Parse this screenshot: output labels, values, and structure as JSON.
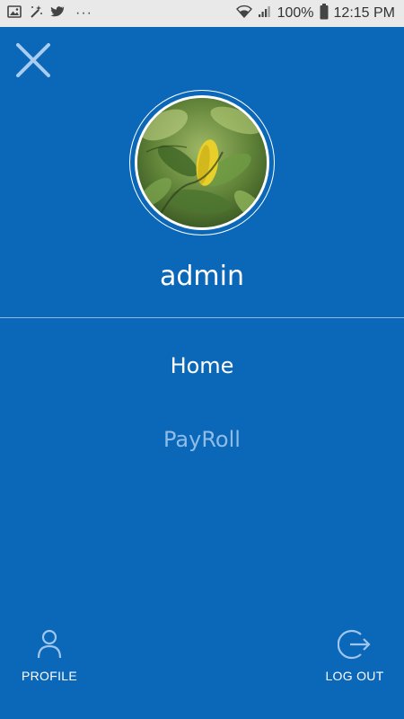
{
  "status_bar": {
    "dots": "···",
    "battery": "100%",
    "time": "12:15 PM",
    "icons": [
      "image-icon",
      "magic-wand-icon",
      "twitter-icon",
      "wifi-icon",
      "signal-icon",
      "battery-icon"
    ]
  },
  "drawer": {
    "close_icon": "close-icon",
    "username": "admin",
    "menu": [
      {
        "label": "Home",
        "active": true
      },
      {
        "label": "PayRoll",
        "active": false
      }
    ],
    "profile_label": "PROFILE",
    "logout_label": "LOG OUT"
  },
  "colors": {
    "background": "#0b67b7",
    "active_text": "#ffffff",
    "inactive_text": "#8fbde8",
    "icon_blue": "#9ec6ee"
  }
}
